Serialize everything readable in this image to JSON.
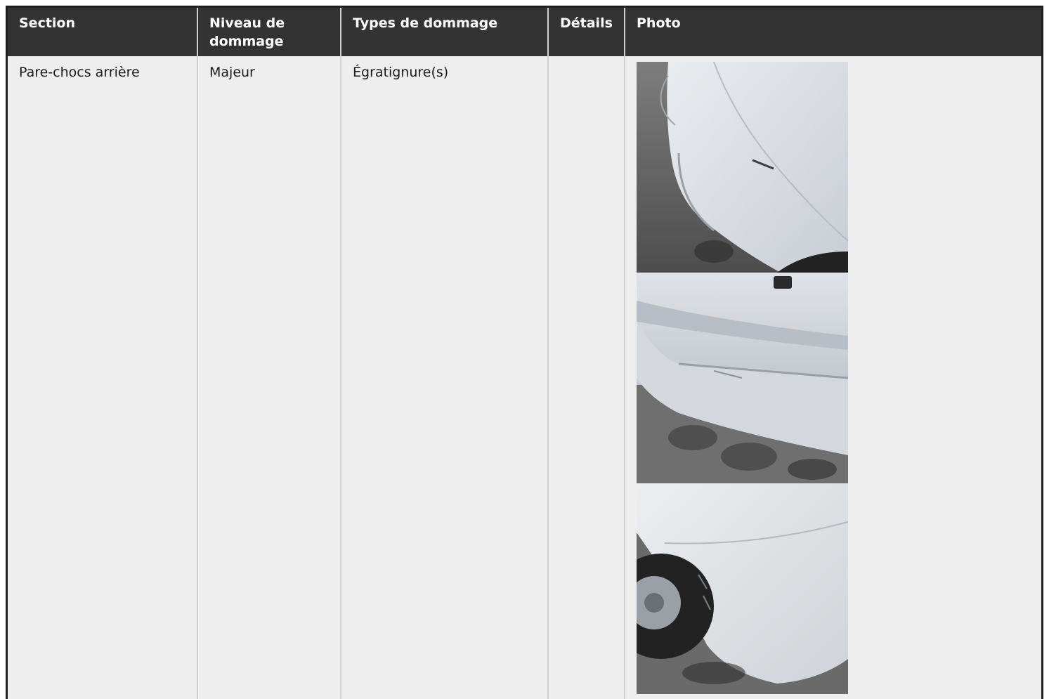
{
  "table": {
    "headers": {
      "section": "Section",
      "level": "Niveau de dommage",
      "types": "Types de dommage",
      "details": "Détails",
      "photo": "Photo"
    },
    "rows": [
      {
        "section": "Pare-chocs arrière",
        "level": "Majeur",
        "types": "Égratignure(s)",
        "details": "",
        "photos": [
          "car-damage-photo-1",
          "car-damage-photo-2",
          "car-damage-photo-3"
        ]
      }
    ]
  },
  "colors": {
    "header_bg": "#333333",
    "cell_bg": "#eeeeee",
    "border": "#1f1f1f"
  }
}
